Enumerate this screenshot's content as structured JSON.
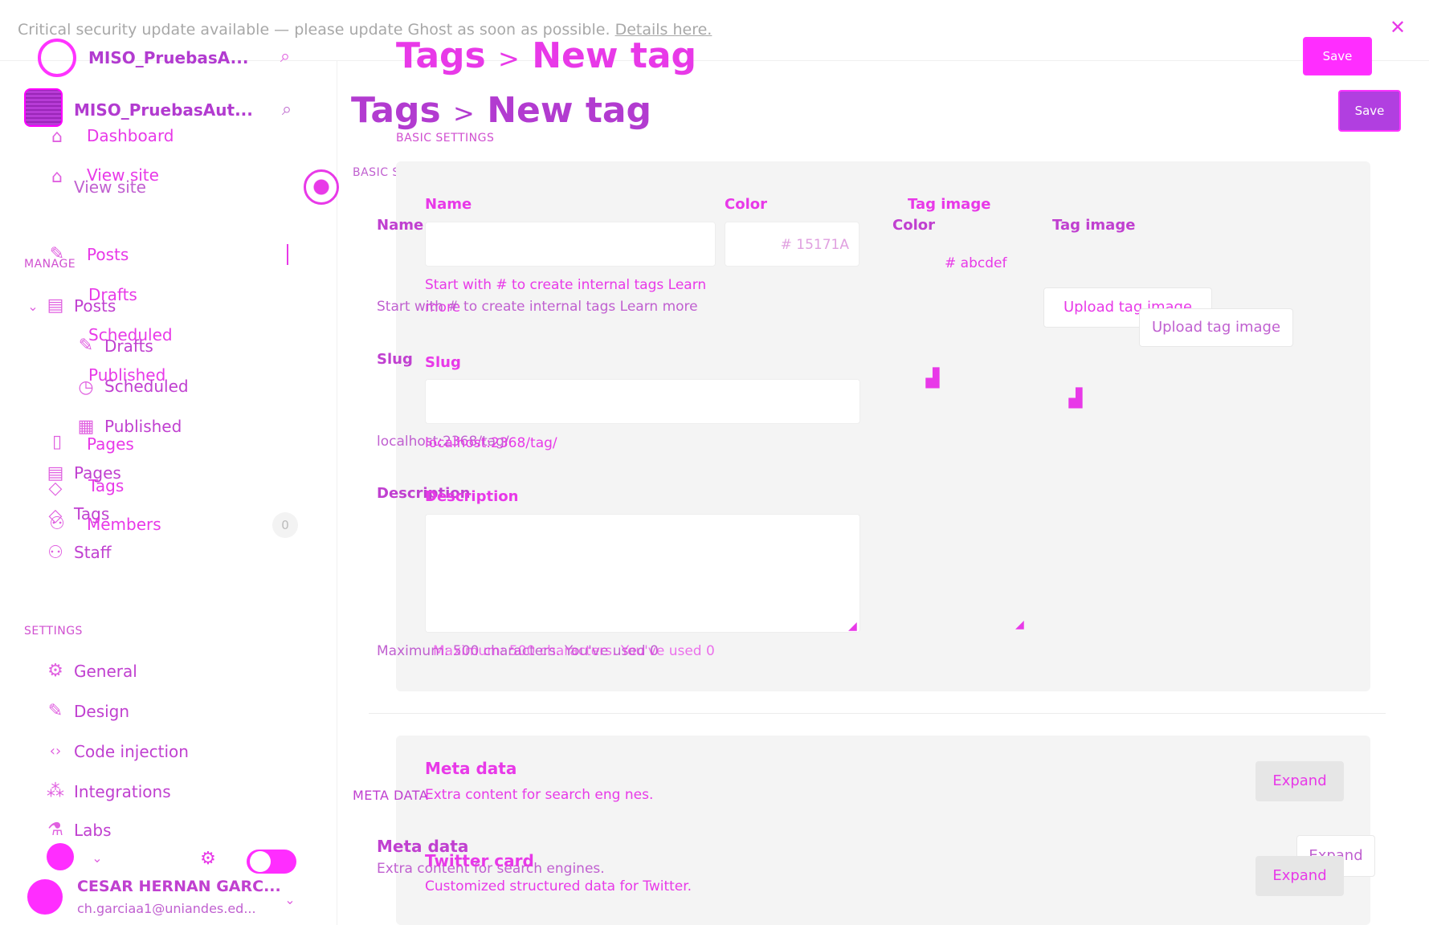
{
  "banner": {
    "text": "Critical security update available — please update Ghost as soon as possible.",
    "link": "Details here."
  },
  "sidebar": {
    "site_name_ghost": "MISO_PruebasA...",
    "site_name": "MISO_PruebasAut...",
    "dashboard": "Dashboard",
    "view_site": "View site",
    "view_site_ghost": "View site",
    "manage_label": "MANAGE",
    "posts": "Posts",
    "posts_ghost": "Posts",
    "drafts": "Drafts",
    "drafts_ghost": "Drafts",
    "scheduled": "Scheduled",
    "scheduled_ghost": "Scheduled",
    "published": "Published",
    "published_ghost": "Published",
    "pages": "Pages",
    "pages_ghost": "Pages",
    "tags": "Tags",
    "tags_ghost": "Tags",
    "members": "Members",
    "members_count": "0",
    "staff": "Staff",
    "settings_label": "SETTINGS",
    "general": "General",
    "design": "Design",
    "code_injection": "Code injection",
    "integrations": "Integrations",
    "labs": "Labs",
    "user_name": "CESAR HERNAN GARC...",
    "user_email": "ch.garciaa1@uniandes.ed..."
  },
  "header": {
    "breadcrumb_parent": "Tags",
    "breadcrumb_sep": ">",
    "breadcrumb_current": "New tag",
    "save": "Save"
  },
  "basic": {
    "section_label": "BASIC SETTINGS",
    "name_label": "Name",
    "name_value": "",
    "color_label": "Color",
    "color_value": "# 15171A",
    "color_value_ghost": "# abcdef",
    "image_label": "Tag image",
    "upload_label": "Upload tag image",
    "name_hint": "Start with # to create internal tags Learn more",
    "name_hint_ghost_a": "Start with # to create internal tags Learn",
    "name_hint_ghost_b": "more",
    "slug_label": "Slug",
    "slug_url": "localhost:2368/tag/",
    "slug_url_ghost": "localhost:2368/tag/",
    "description_label": "Description",
    "description_hint": "Maximum: 500 characters. You've used 0",
    "description_hint_ghost": "Maximum: 500 characters. You've used 0"
  },
  "meta": {
    "section_label": "META DATA",
    "title": "Meta data",
    "subtitle": "Extra content for search engines.",
    "subtitle_ghost": "Extra content for search eng nes.",
    "expand": "Expand",
    "twitter_title": "Twitter card",
    "twitter_subtitle": "Customized structured data for Twitter."
  },
  "colors": {
    "accent": "#e839e8",
    "save_button": "#b13fe0",
    "panel": "#f4f4f4"
  }
}
